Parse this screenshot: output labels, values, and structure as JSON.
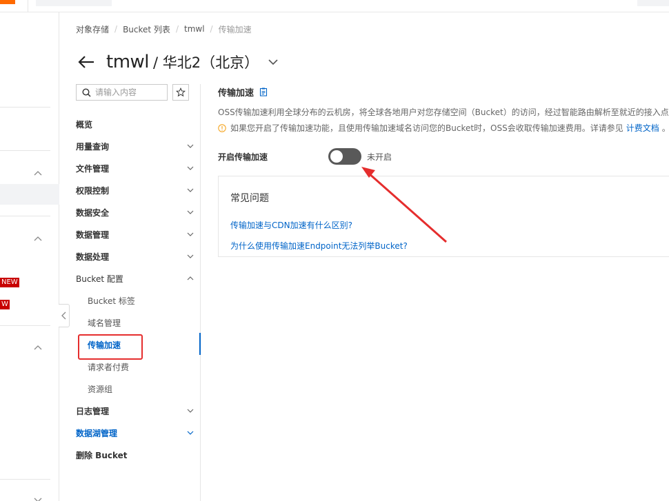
{
  "breadcrumb": {
    "items": [
      "对象存储",
      "Bucket 列表",
      "tmwl",
      "传输加速"
    ]
  },
  "header": {
    "bucket_name": "tmwl",
    "region": "/ 华北2（北京）"
  },
  "bucket_nav": {
    "search_placeholder": "请输入内容",
    "items": [
      {
        "label": "概览"
      },
      {
        "label": "用量查询"
      },
      {
        "label": "文件管理"
      },
      {
        "label": "权限控制"
      },
      {
        "label": "数据安全"
      },
      {
        "label": "数据管理"
      },
      {
        "label": "数据处理"
      },
      {
        "label": "Bucket 配置"
      },
      {
        "label": "日志管理"
      },
      {
        "label": "数据湖管理"
      },
      {
        "label": "删除 Bucket"
      }
    ],
    "sub_items": [
      {
        "label": "Bucket 标签"
      },
      {
        "label": "域名管理"
      },
      {
        "label": "传输加速"
      },
      {
        "label": "请求者付费"
      },
      {
        "label": "资源组"
      }
    ]
  },
  "global_sidebar": {
    "badges": [
      "NEW",
      "W"
    ]
  },
  "main": {
    "section_title": "传输加速",
    "description": "OSS传输加速利用全球分布的云机房，将全球各地用户对您存储空间（Bucket）的访问，经过智能路由解析至就近的接入点，",
    "warning": "如果您开启了传输加速功能，且使用传输加速域名访问您的Bucket时，OSS会收取传输加速费用。详请参见",
    "warning_link": "计费文档",
    "warning_end": "。",
    "toggle_label": "开启传输加速",
    "toggle_state": "未开启",
    "toggle_on": false,
    "faq": {
      "title": "常见问题",
      "links": [
        "传输加速与CDN加速有什么区别?",
        "为什么使用传输加速Endpoint无法列举Bucket?"
      ]
    }
  },
  "colors": {
    "accent": "#0064c8",
    "annotation": "#e52d2d",
    "switch_off": "#595959",
    "badge": "#c80000"
  }
}
